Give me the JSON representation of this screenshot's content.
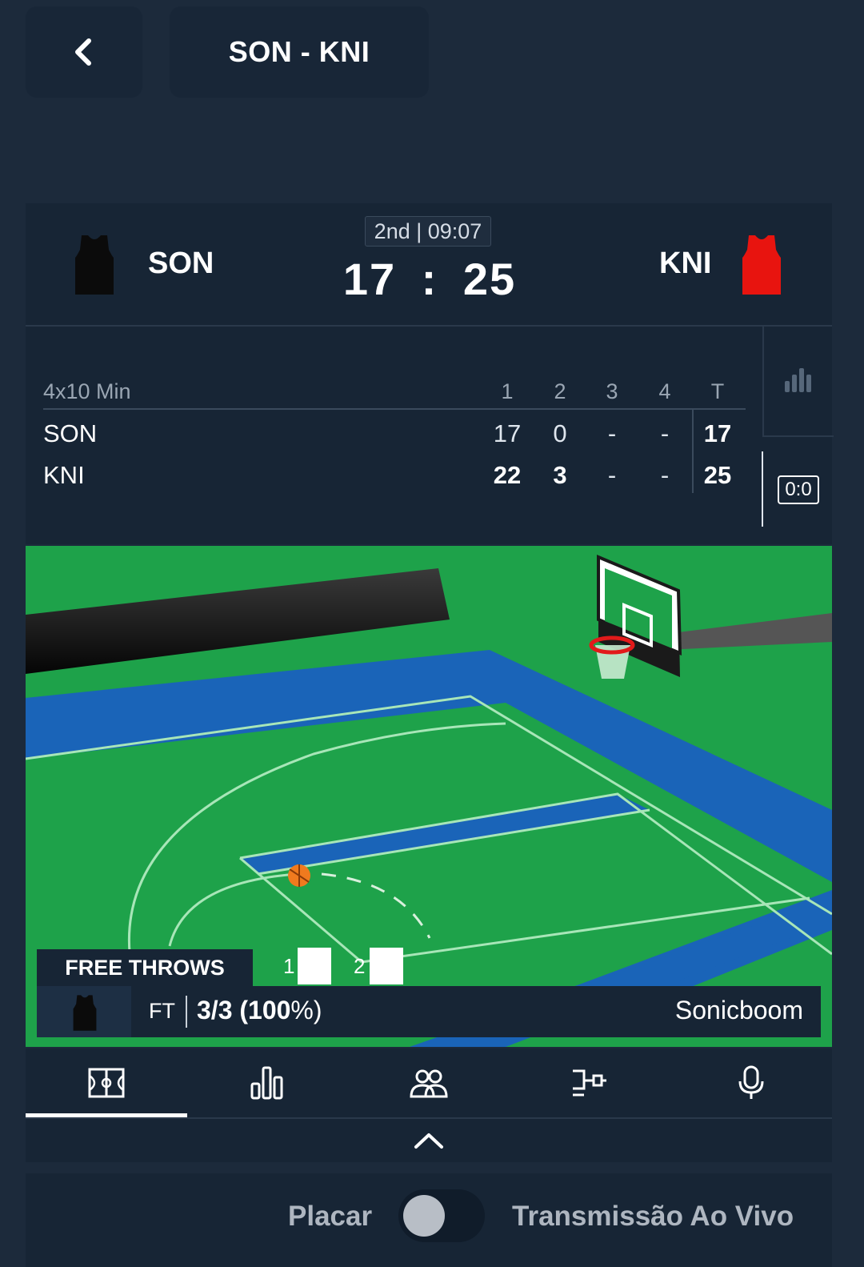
{
  "header": {
    "back_icon": "chevron-left-icon",
    "match_title": "SON - KNI"
  },
  "scoreboard": {
    "period_clock": "2nd | 09:07",
    "home": {
      "name": "SON",
      "score": "17",
      "jersey_color": "#0b0b0b"
    },
    "away": {
      "name": "KNI",
      "score": "25",
      "jersey_color": "#e8140f"
    },
    "separator": ":"
  },
  "boxscore": {
    "format": "4x10 Min",
    "columns": [
      "1",
      "2",
      "3",
      "4",
      "T"
    ],
    "rows": [
      {
        "team": "SON",
        "cells": [
          "17",
          "0",
          "-",
          "-",
          "17"
        ]
      },
      {
        "team": "KNI",
        "cells": [
          "22",
          "3",
          "-",
          "-",
          "25"
        ]
      }
    ],
    "side_icons": [
      "bar-chart-icon",
      "score-0-0-icon"
    ],
    "side_score_label": "0:0"
  },
  "court": {
    "event_title": "FREE THROWS",
    "attempts": [
      {
        "number": "1",
        "made": true
      },
      {
        "number": "2",
        "made": true
      }
    ],
    "stat_label": "FT",
    "stat_value": "3/3 (100",
    "stat_percent": "%)",
    "team_name": "Sonicboom",
    "colors": {
      "court": "#1ea24a",
      "paint": "#1a64b8",
      "lines": "#a8e6b8"
    }
  },
  "tabs": [
    {
      "name": "court",
      "icon": "court-icon",
      "active": true
    },
    {
      "name": "stats",
      "icon": "bar-chart-icon",
      "active": false
    },
    {
      "name": "lineups",
      "icon": "players-icon",
      "active": false
    },
    {
      "name": "bracket",
      "icon": "bracket-icon",
      "active": false
    },
    {
      "name": "commentary",
      "icon": "microphone-icon",
      "active": false
    }
  ],
  "collapse_icon": "chevron-up-icon",
  "toggle": {
    "left_label": "Placar",
    "right_label": "Transmissão Ao Vivo",
    "state": "off"
  }
}
